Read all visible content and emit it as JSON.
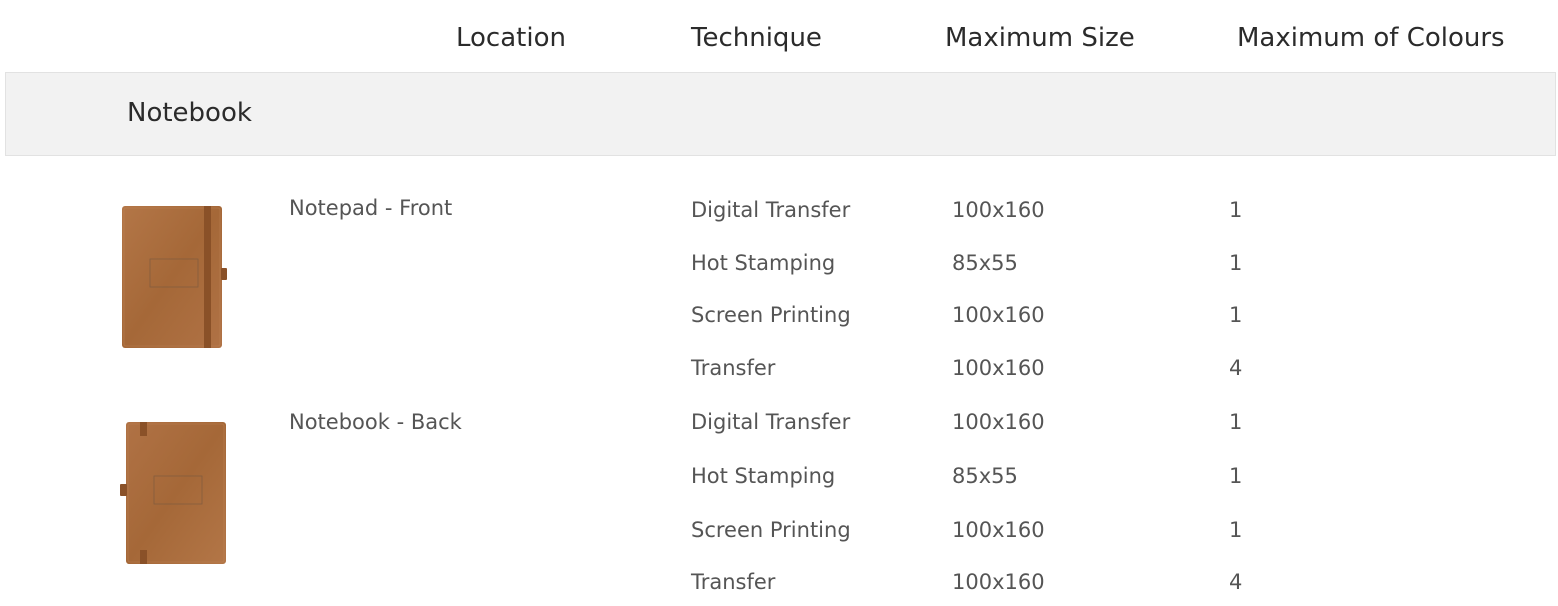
{
  "table": {
    "headers": {
      "location": "Location",
      "technique": "Technique",
      "max_size": "Maximum Size",
      "max_colours": "Maximum of Colours"
    },
    "group": {
      "title": "Notebook",
      "locations": [
        {
          "name": "Notepad - Front",
          "image": "notebook-front-image",
          "rows": [
            {
              "technique": "Digital Transfer",
              "size": "100x160",
              "colours": "1"
            },
            {
              "technique": "Hot Stamping",
              "size": "85x55",
              "colours": "1"
            },
            {
              "technique": "Screen Printing",
              "size": "100x160",
              "colours": "1"
            },
            {
              "technique": "Transfer",
              "size": "100x160",
              "colours": "4"
            }
          ]
        },
        {
          "name": "Notebook - Back",
          "image": "notebook-back-image",
          "rows": [
            {
              "technique": "Digital Transfer",
              "size": "100x160",
              "colours": "1"
            },
            {
              "technique": "Hot Stamping",
              "size": "85x55",
              "colours": "1"
            },
            {
              "technique": "Screen Printing",
              "size": "100x160",
              "colours": "1"
            },
            {
              "technique": "Transfer",
              "size": "100x160",
              "colours": "4"
            }
          ]
        }
      ]
    }
  },
  "colors": {
    "notebook_leather": "#a86a3c",
    "notebook_dark": "#8a5128",
    "band_background": "#f2f2f2"
  }
}
